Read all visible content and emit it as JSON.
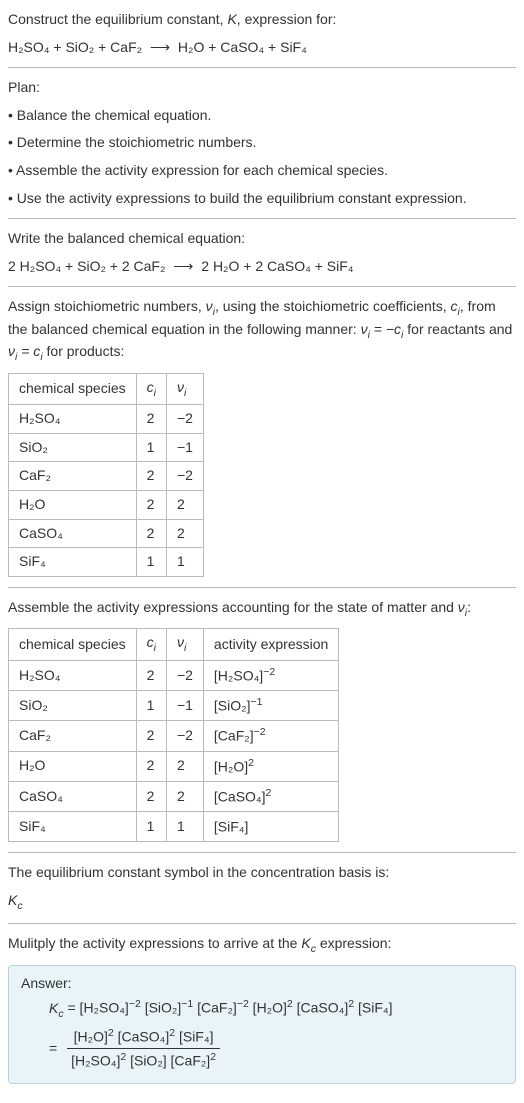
{
  "intro": {
    "line1_a": "Construct the equilibrium constant, ",
    "line1_b": ", expression for:",
    "equation_lhs": "H₂SO₄ + SiO₂ + CaF₂",
    "arrow": "⟶",
    "equation_rhs": "H₂O + CaSO₄ + SiF₄"
  },
  "plan": {
    "heading": "Plan:",
    "bullets": [
      "Balance the chemical equation.",
      "Determine the stoichiometric numbers.",
      "Assemble the activity expression for each chemical species.",
      "Use the activity expressions to build the equilibrium constant expression."
    ]
  },
  "balanced": {
    "heading": "Write the balanced chemical equation:",
    "lhs": "2 H₂SO₄ + SiO₂ + 2 CaF₂",
    "arrow": "⟶",
    "rhs": "2 H₂O + 2 CaSO₄ + SiF₄"
  },
  "assign": {
    "text_a": "Assign stoichiometric numbers, ",
    "nu": "ν",
    "text_b": ", using the stoichiometric coefficients, ",
    "c": "c",
    "text_c": ", from the balanced chemical equation in the following manner: ",
    "eq1": "νᵢ = −cᵢ",
    "text_d": " for reactants and ",
    "eq2": "νᵢ = cᵢ",
    "text_e": " for products:"
  },
  "table1": {
    "headers": [
      "chemical species",
      "cᵢ",
      "νᵢ"
    ],
    "rows": [
      [
        "H₂SO₄",
        "2",
        "−2"
      ],
      [
        "SiO₂",
        "1",
        "−1"
      ],
      [
        "CaF₂",
        "2",
        "−2"
      ],
      [
        "H₂O",
        "2",
        "2"
      ],
      [
        "CaSO₄",
        "2",
        "2"
      ],
      [
        "SiF₄",
        "1",
        "1"
      ]
    ]
  },
  "assemble_text_a": "Assemble the activity expressions accounting for the state of matter and ",
  "assemble_text_b": ":",
  "table2": {
    "headers": [
      "chemical species",
      "cᵢ",
      "νᵢ",
      "activity expression"
    ],
    "rows": [
      {
        "sp": "H₂SO₄",
        "c": "2",
        "v": "−2",
        "a_base": "[H₂SO₄]",
        "a_exp": "−2"
      },
      {
        "sp": "SiO₂",
        "c": "1",
        "v": "−1",
        "a_base": "[SiO₂]",
        "a_exp": "−1"
      },
      {
        "sp": "CaF₂",
        "c": "2",
        "v": "−2",
        "a_base": "[CaF₂]",
        "a_exp": "−2"
      },
      {
        "sp": "H₂O",
        "c": "2",
        "v": "2",
        "a_base": "[H₂O]",
        "a_exp": "2"
      },
      {
        "sp": "CaSO₄",
        "c": "2",
        "v": "2",
        "a_base": "[CaSO₄]",
        "a_exp": "2"
      },
      {
        "sp": "SiF₄",
        "c": "1",
        "v": "1",
        "a_base": "[SiF₄]",
        "a_exp": ""
      }
    ]
  },
  "symbol_text": "The equilibrium constant symbol in the concentration basis is:",
  "kc": "K",
  "kc_sub": "c",
  "multiply_text_a": "Mulitply the activity expressions to arrive at the ",
  "multiply_text_b": " expression:",
  "answer": {
    "label": "Answer:",
    "line1": "Kc = [H₂SO₄]⁻² [SiO₂]⁻¹ [CaF₂]⁻² [H₂O]² [CaSO₄]² [SiF₄]",
    "frac_num": "[H₂O]² [CaSO₄]² [SiF₄]",
    "frac_den": "[H₂SO₄]² [SiO₂] [CaF₂]²"
  }
}
